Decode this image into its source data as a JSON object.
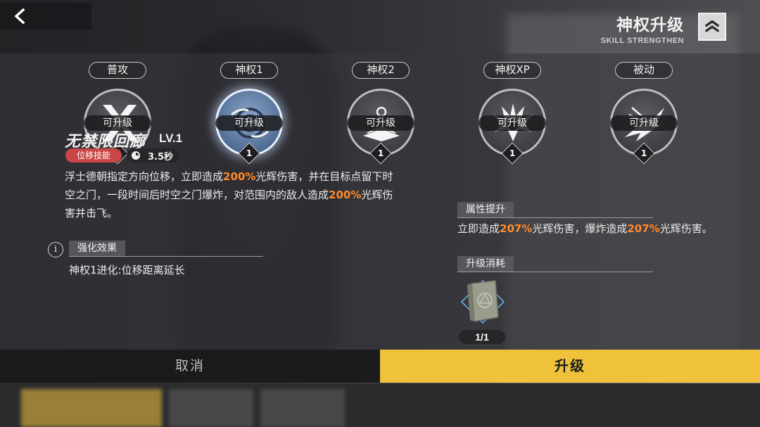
{
  "header": {
    "title": "神权升级",
    "subtitle": "SKILL STRENGTHEN"
  },
  "skills": [
    {
      "tab": "普攻",
      "status": "可升级",
      "level": "1",
      "icon": "cross-x-icon",
      "selected": false
    },
    {
      "tab": "神权1",
      "status": "可升级",
      "level": "1",
      "icon": "portal-vortex-icon",
      "selected": true
    },
    {
      "tab": "神权2",
      "status": "可升级",
      "level": "1",
      "icon": "orb-book-icon",
      "selected": false
    },
    {
      "tab": "神权XP",
      "status": "可升级",
      "level": "1",
      "icon": "flame-burst-icon",
      "selected": false
    },
    {
      "tab": "被动",
      "status": "可升级",
      "level": "1",
      "icon": "slash-burst-icon",
      "selected": false
    }
  ],
  "detail": {
    "name": "无禁限回廊",
    "level": "LV.1",
    "type_badge": "位移技能",
    "cooldown": "3.5秒",
    "desc_1": "浮士德朝指定方向位移，立即造成",
    "desc_2": "200%",
    "desc_3": "光辉伤害，并在目标点留下时空之门，一段时间后时空之门爆炸，对范围内的敌人造成",
    "desc_4": "200%",
    "desc_5": "光辉伤害并击飞。",
    "enhance_label": "强化效果",
    "enhance_text": "神权1进化:位移距离延长"
  },
  "attributes": {
    "label": "属性提升",
    "text_1": "立即造成",
    "text_2": "207%",
    "text_3": "光辉伤害，爆炸造成",
    "text_4": "207%",
    "text_5": "光辉伤害。"
  },
  "cost": {
    "label": "升级消耗",
    "item_icon": "skill-book-icon",
    "count": "1/1"
  },
  "buttons": {
    "cancel": "取消",
    "upgrade": "升级"
  },
  "colors": {
    "highlight": "#ff8a2a",
    "upgrade_button": "#f0c23b",
    "type_badge": "#c94646"
  }
}
